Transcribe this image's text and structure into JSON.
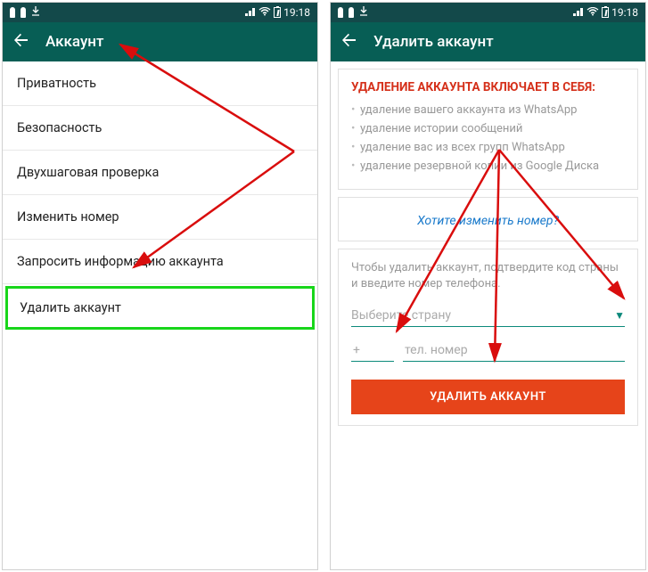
{
  "status": {
    "time": "19:18"
  },
  "left": {
    "title": "Аккаунт",
    "items": [
      "Приватность",
      "Безопасность",
      "Двухшаговая проверка",
      "Изменить номер",
      "Запросить информацию аккаунта",
      "Удалить аккаунт"
    ]
  },
  "right": {
    "title": "Удалить аккаунт",
    "card_title": "УДАЛЕНИЕ АККАУНТА ВКЛЮЧАЕТ В СЕБЯ:",
    "bullets": [
      "удаление вашего аккаунта из WhatsApp",
      "удаление истории сообщений",
      "удаление вас из всех групп WhatsApp",
      "удаление резервной копии из Google Диска"
    ],
    "change_number": "Хотите изменить номер?",
    "confirm_text": "Чтобы удалить аккаунт, подтвердите код страны и введите номер телефона.",
    "country_placeholder": "Выберите страну",
    "cc_prefix": "+",
    "phone_placeholder": "тел. номер",
    "delete_button": "УДАЛИТЬ АККАУНТ"
  }
}
